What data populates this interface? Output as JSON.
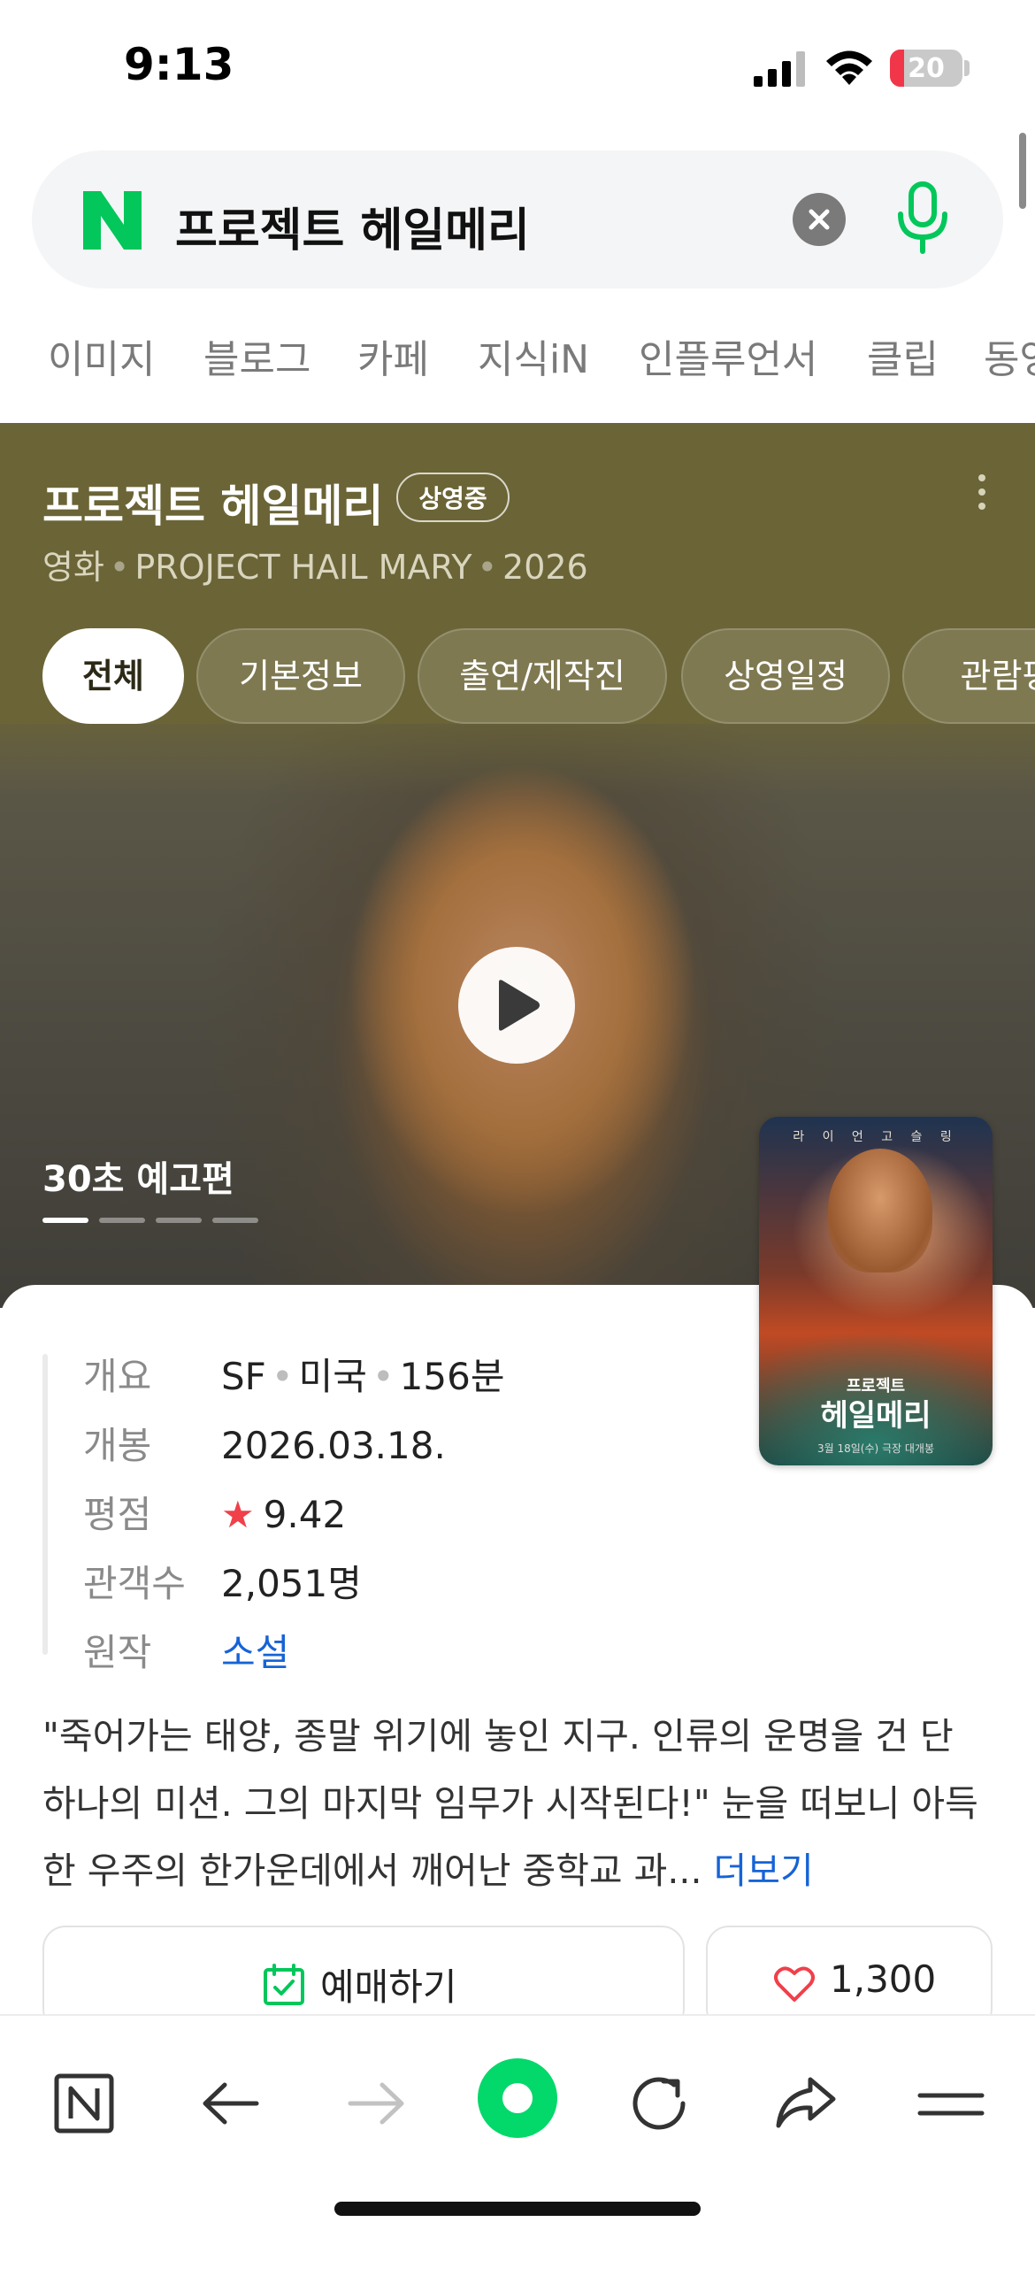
{
  "status_bar": {
    "time": "9:13",
    "battery": "20",
    "battery_level": 0.2
  },
  "search": {
    "query": "프로젝트 헤일메리"
  },
  "vertical_tabs": [
    "이미지",
    "블로그",
    "카페",
    "지식iN",
    "인플루언서",
    "클립",
    "동영"
  ],
  "movie": {
    "title": "프로젝트 헤일메리",
    "status_badge": "상영중",
    "meta": {
      "type": "영화",
      "english_title": "PROJECT HAIL MARY",
      "year": "2026"
    },
    "tabs": [
      "전체",
      "기본정보",
      "출연/제작진",
      "상영일정",
      "관람평"
    ],
    "active_tab": "전체",
    "trailer_label": "30초 예고편",
    "trailer_pages": 4,
    "trailer_current": 1,
    "poster": {
      "top_text": "라 이 언 고 슬 링",
      "title_small": "프로젝트",
      "title_large": "헤일메리",
      "release_note": "3월 18일(수) 극장 대개봉"
    },
    "info": {
      "overview_label": "개요",
      "overview": [
        "SF",
        "미국",
        "156분"
      ],
      "release_label": "개봉",
      "release": "2026.03.18.",
      "rating_label": "평점",
      "rating": "9.42",
      "audience_label": "관객수",
      "audience": "2,051명",
      "original_label": "원작",
      "original": "소설"
    },
    "synopsis": "\"죽어가는 태양, 종말 위기에 놓인 지구. 인류의 운명을 건 단 하나의 미션. 그의 마지막 임무가 시작된다!\" 눈을 떠보니 아득한 우주의 한가운데에서 깨어난 중학교 과...",
    "more_label": "더보기",
    "book_label": "예매하기",
    "like_count": "1,300"
  },
  "colors": {
    "naver_green": "#03c75a",
    "panel_bg": "#6b6436",
    "link_blue": "#1663d6",
    "star_red": "#f0404a"
  },
  "toolbar": {
    "icons": [
      "naver-home-icon",
      "back-arrow-icon",
      "forward-arrow-icon",
      "green-dot-icon",
      "reload-icon",
      "share-icon",
      "menu-icon"
    ]
  }
}
